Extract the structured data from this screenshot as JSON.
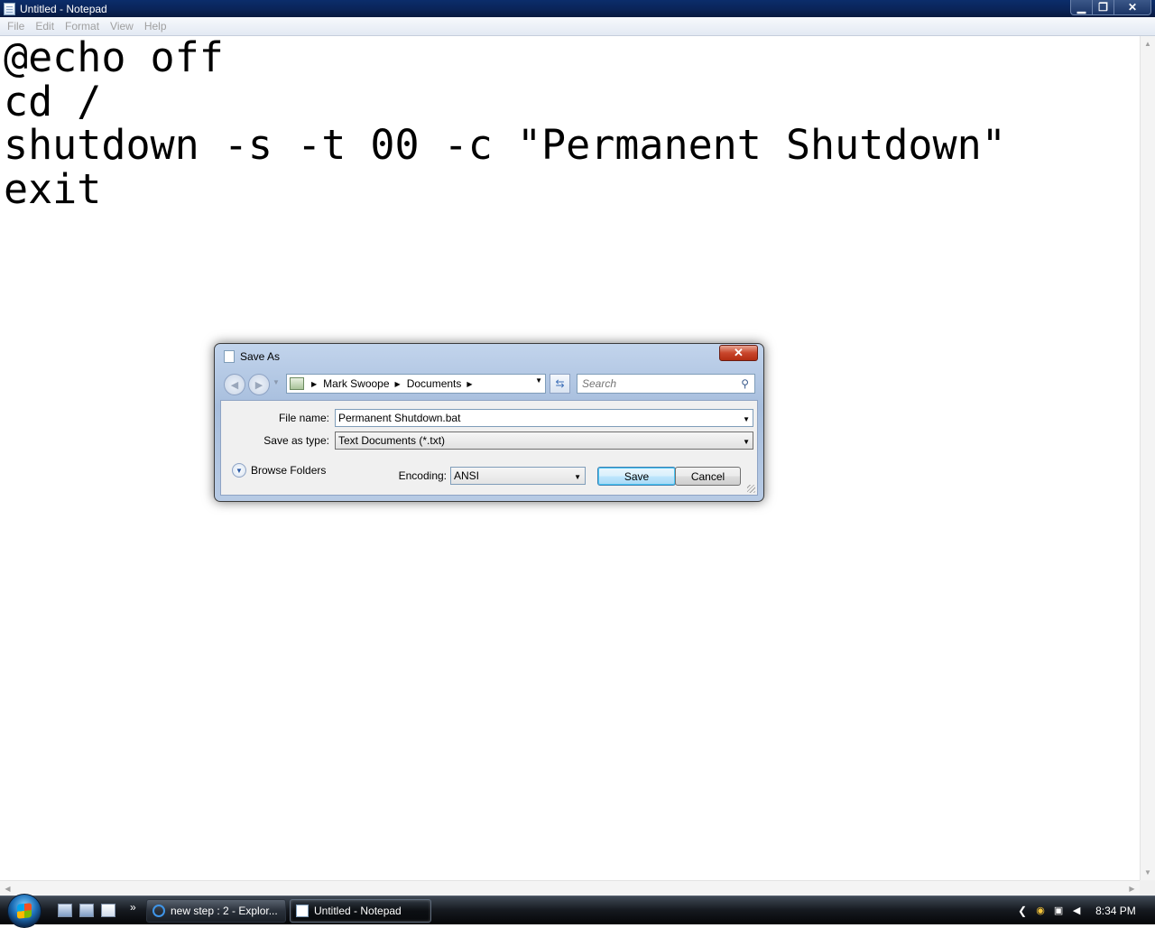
{
  "window": {
    "title": "Untitled - Notepad",
    "min_glyph": "▁",
    "max_glyph": "❐",
    "close_glyph": "✕"
  },
  "menu": [
    "File",
    "Edit",
    "Format",
    "View",
    "Help"
  ],
  "editor": {
    "text": "@echo off\ncd /\nshutdown -s -t 00 -c \"Permanent Shutdown\"\nexit"
  },
  "dialog": {
    "title": "Save As",
    "close_glyph": "✕",
    "breadcrumbs": [
      "Mark Swoope",
      "Documents"
    ],
    "search_placeholder": "Search",
    "file_name_label": "File name:",
    "file_name_value": "Permanent Shutdown.bat",
    "save_type_label": "Save as type:",
    "save_type_value": "Text Documents (*.txt)",
    "browse_folders_label": "Browse Folders",
    "encoding_label": "Encoding:",
    "encoding_value": "ANSI",
    "save_label": "Save",
    "cancel_label": "Cancel"
  },
  "taskbar": {
    "ql_more": "»",
    "tasks": [
      "new step : 2 - Explor...",
      "Untitled - Notepad"
    ],
    "clock": "8:34 PM"
  },
  "colors": {
    "titlebar": "#0a2458",
    "dialog_frame": "#a7bedd",
    "save_button": "#bee6fd",
    "taskbar": "#15191f"
  }
}
